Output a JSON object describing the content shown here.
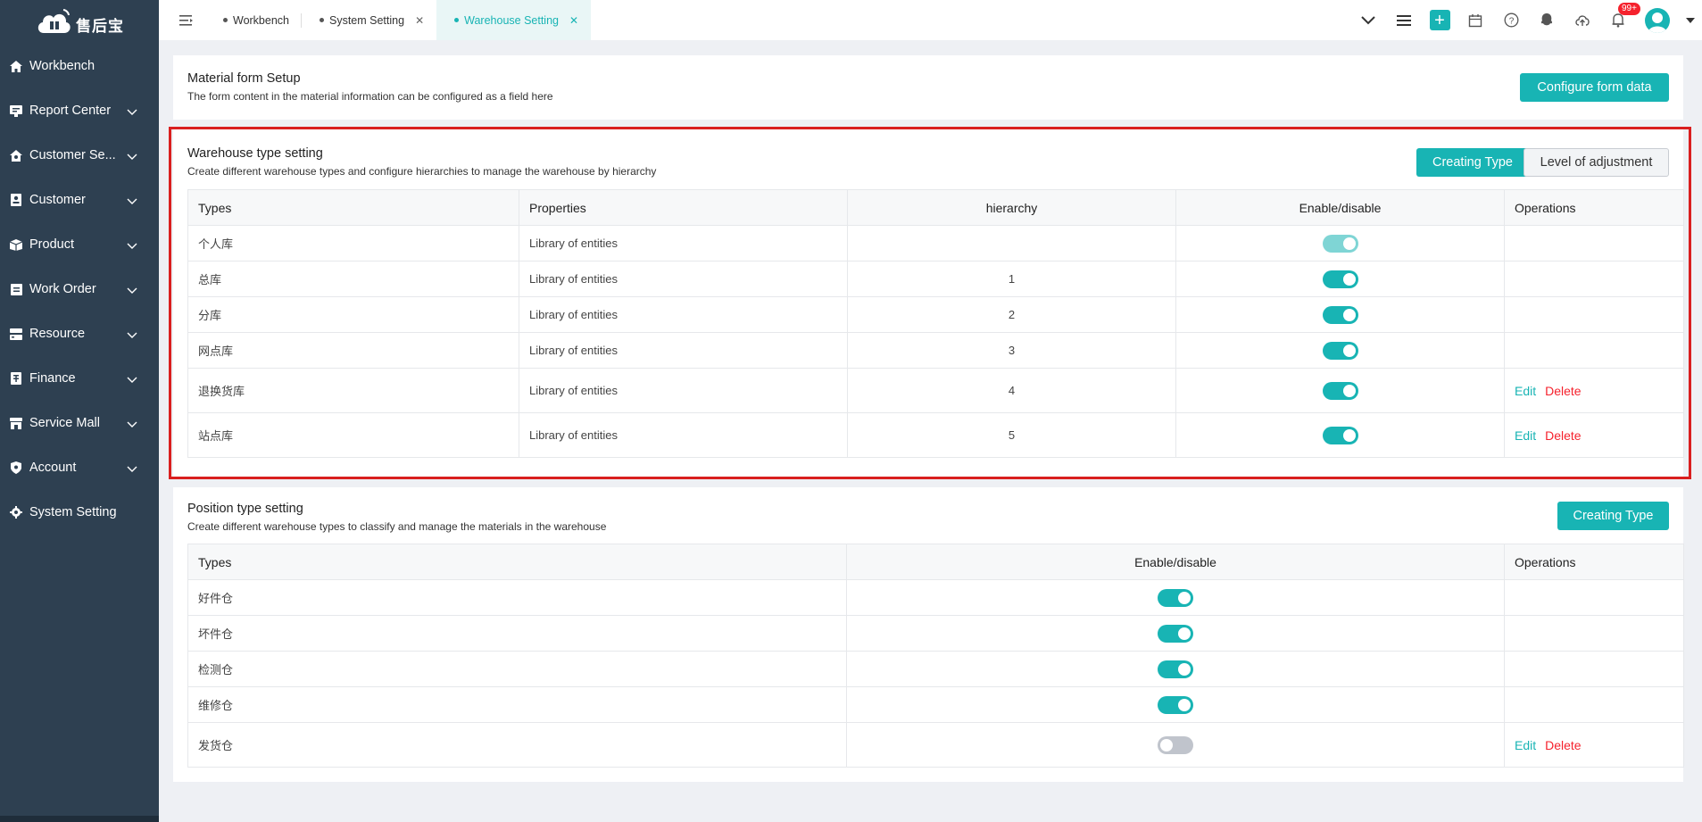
{
  "app": {
    "logo_text": "售后宝"
  },
  "sidebar": {
    "items": [
      {
        "label": "Workbench",
        "icon": "home-icon",
        "expandable": false
      },
      {
        "label": "Report Center",
        "icon": "report-icon",
        "expandable": true
      },
      {
        "label": "Customer Se...",
        "icon": "service-icon",
        "expandable": true
      },
      {
        "label": "Customer",
        "icon": "contact-icon",
        "expandable": true
      },
      {
        "label": "Product",
        "icon": "box-icon",
        "expandable": true
      },
      {
        "label": "Work Order",
        "icon": "work-order-icon",
        "expandable": true
      },
      {
        "label": "Resource",
        "icon": "resource-icon",
        "expandable": true
      },
      {
        "label": "Finance",
        "icon": "finance-icon",
        "expandable": true
      },
      {
        "label": "Service Mall",
        "icon": "store-icon",
        "expandable": true
      },
      {
        "label": "Account",
        "icon": "shield-icon",
        "expandable": true
      },
      {
        "label": "System Setting",
        "icon": "gear-icon",
        "expandable": false
      }
    ]
  },
  "tabs": [
    {
      "label": "Workbench",
      "closable": false,
      "active": false
    },
    {
      "label": "System Setting",
      "closable": true,
      "active": false
    },
    {
      "label": "Warehouse Setting",
      "closable": true,
      "active": true
    }
  ],
  "header": {
    "notification_badge": "99+"
  },
  "material_form": {
    "title": "Material form Setup",
    "desc": "The form content in the material information can be configured as a field here",
    "button": "Configure form data"
  },
  "warehouse_type": {
    "title": "Warehouse type setting",
    "desc": "Create different warehouse types and configure hierarchies to manage the warehouse by hierarchy",
    "create_button": "Creating Type",
    "adjust_button": "Level of adjustment",
    "columns": [
      "Types",
      "Properties",
      "hierarchy",
      "Enable/disable",
      "Operations"
    ],
    "rows": [
      {
        "type": "个人库",
        "property": "Library of entities",
        "hierarchy": "",
        "enabled": true,
        "locked": true,
        "editable": false
      },
      {
        "type": "总库",
        "property": "Library of entities",
        "hierarchy": "1",
        "enabled": true,
        "locked": false,
        "editable": false
      },
      {
        "type": "分库",
        "property": "Library of entities",
        "hierarchy": "2",
        "enabled": true,
        "locked": false,
        "editable": false
      },
      {
        "type": "网点库",
        "property": "Library of entities",
        "hierarchy": "3",
        "enabled": true,
        "locked": false,
        "editable": false
      },
      {
        "type": "退换货库",
        "property": "Library of entities",
        "hierarchy": "4",
        "enabled": true,
        "locked": false,
        "editable": true
      },
      {
        "type": "站点库",
        "property": "Library of entities",
        "hierarchy": "5",
        "enabled": true,
        "locked": false,
        "editable": true
      }
    ],
    "edit_label": "Edit",
    "delete_label": "Delete"
  },
  "position_type": {
    "title": "Position type setting",
    "desc": "Create different warehouse types to classify and manage the materials in the warehouse",
    "create_button": "Creating Type",
    "columns": [
      "Types",
      "Enable/disable",
      "Operations"
    ],
    "rows": [
      {
        "type": "好件仓",
        "enabled": true,
        "editable": false
      },
      {
        "type": "坏件仓",
        "enabled": true,
        "editable": false
      },
      {
        "type": "检测仓",
        "enabled": true,
        "editable": false
      },
      {
        "type": "维修仓",
        "enabled": true,
        "editable": false
      },
      {
        "type": "发货仓",
        "enabled": false,
        "editable": true
      }
    ],
    "edit_label": "Edit",
    "delete_label": "Delete"
  },
  "colors": {
    "accent": "#18b4b4",
    "sidebar": "#2e4051",
    "danger": "#f5222d",
    "highlight": "#d91f1f"
  }
}
